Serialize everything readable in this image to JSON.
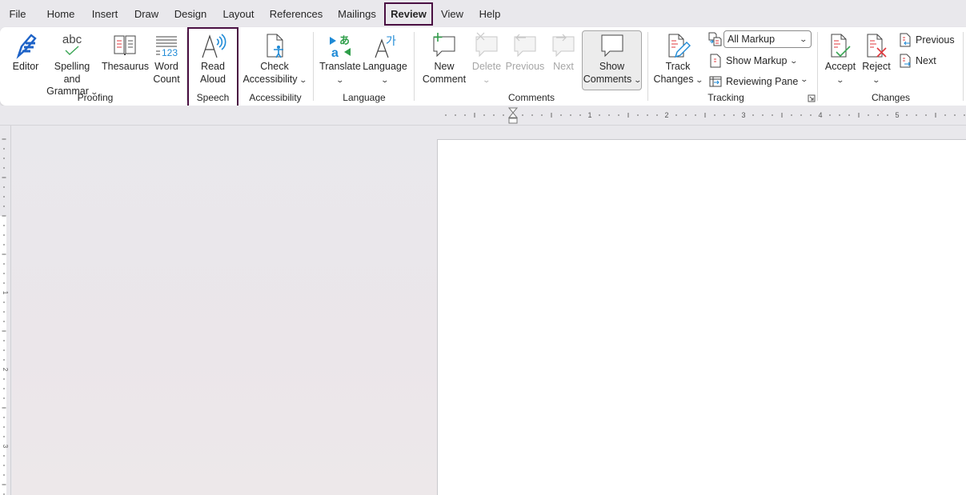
{
  "tabs": [
    {
      "label": "File"
    },
    {
      "label": "Home"
    },
    {
      "label": "Insert"
    },
    {
      "label": "Draw"
    },
    {
      "label": "Design"
    },
    {
      "label": "Layout"
    },
    {
      "label": "References"
    },
    {
      "label": "Mailings"
    },
    {
      "label": "Review",
      "active": true
    },
    {
      "label": "View"
    },
    {
      "label": "Help"
    }
  ],
  "ribbon": {
    "proofing": {
      "group_label": "Proofing",
      "editor": "Editor",
      "spelling_line1": "Spelling and",
      "spelling_line2": "Grammar",
      "thesaurus": "Thesaurus",
      "word_count_line1": "Word",
      "word_count_line2": "Count"
    },
    "speech": {
      "group_label": "Speech",
      "read_aloud_line1": "Read",
      "read_aloud_line2": "Aloud"
    },
    "accessibility": {
      "group_label": "Accessibility",
      "check_line1": "Check",
      "check_line2": "Accessibility"
    },
    "language": {
      "group_label": "Language",
      "translate": "Translate",
      "language": "Language"
    },
    "comments": {
      "group_label": "Comments",
      "new_line1": "New",
      "new_line2": "Comment",
      "delete": "Delete",
      "previous": "Previous",
      "next": "Next",
      "show_line1": "Show",
      "show_line2": "Comments"
    },
    "tracking": {
      "group_label": "Tracking",
      "track_line1": "Track",
      "track_line2": "Changes",
      "markup_select": "All Markup",
      "show_markup": "Show Markup",
      "reviewing_pane": "Reviewing Pane"
    },
    "changes": {
      "group_label": "Changes",
      "accept": "Accept",
      "reject": "Reject",
      "previous": "Previous",
      "next": "Next"
    }
  },
  "ruler": {
    "h_numbers": [
      "1",
      "2",
      "3",
      "4",
      "5"
    ],
    "v_numbers": [
      "1",
      "2",
      "3"
    ]
  }
}
